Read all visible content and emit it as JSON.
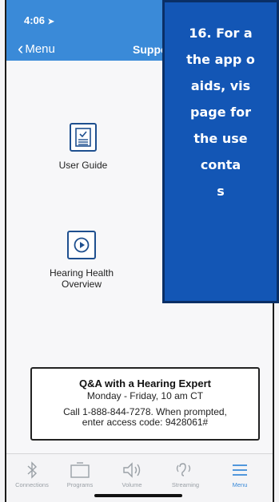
{
  "status": {
    "time": "4:06"
  },
  "header": {
    "back_label": "Menu",
    "title": "Suppo"
  },
  "tiles": [
    {
      "label": "User Guide",
      "icon": "document-icon"
    },
    {
      "label_lines": [
        "Hearing Health",
        "Overview"
      ],
      "icon": "play-icon"
    }
  ],
  "overlay": {
    "lines": [
      "16. For a",
      "the app o",
      "aids, vis",
      "page for",
      "the use",
      "conta",
      "s"
    ]
  },
  "expert": {
    "heading": "Q&A with a Hearing Expert",
    "schedule": "Monday - Friday, 10 am CT",
    "call_line1": "Call 1-888-844-7278. When prompted,",
    "call_line2": "enter access code: 9428061#"
  },
  "tabbar": {
    "items": [
      {
        "label": "Connections",
        "icon": "bluetooth-icon"
      },
      {
        "label": "Programs",
        "icon": "programs-folder-icon"
      },
      {
        "label": "Volume",
        "icon": "volume-speaker-icon"
      },
      {
        "label": "Streaming",
        "icon": "streaming-ear-icon"
      },
      {
        "label": "Menu",
        "icon": "hamburger-menu-icon"
      }
    ],
    "active": "Menu"
  },
  "colors": {
    "header": "#3a8ad8",
    "overlay": "#1356b5",
    "icon_border": "#1e4f8f"
  }
}
